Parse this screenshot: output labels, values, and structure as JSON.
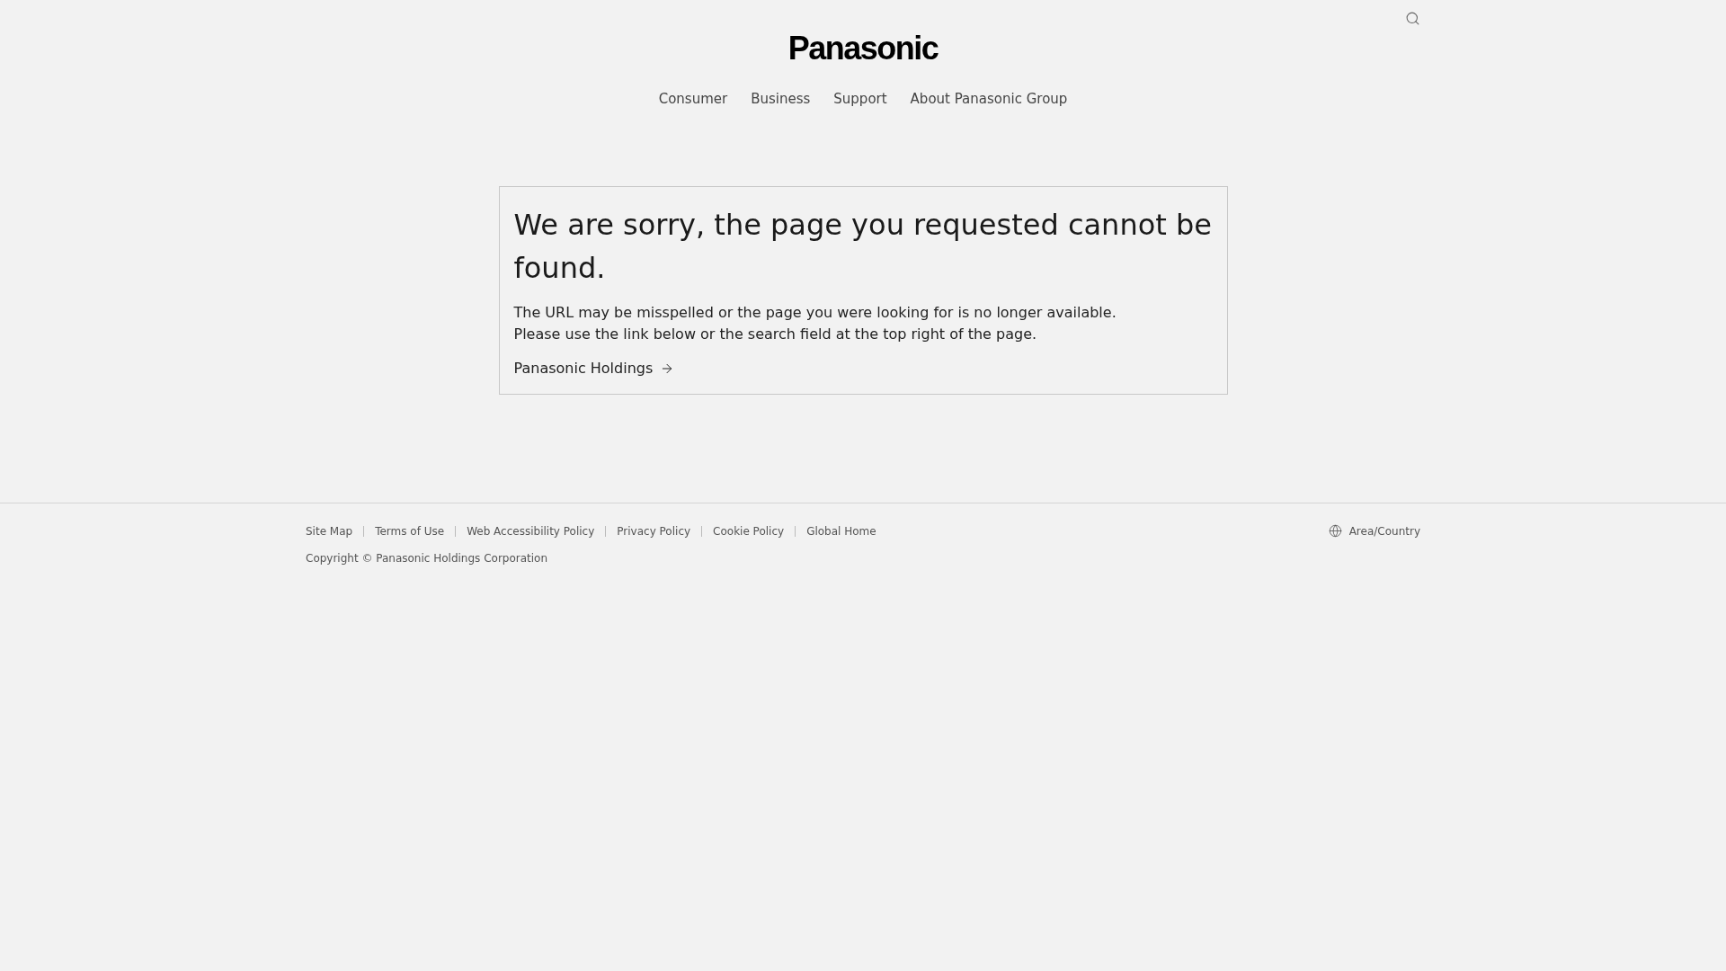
{
  "header": {
    "logo": "Panasonic",
    "nav": [
      {
        "label": "Consumer"
      },
      {
        "label": "Business"
      },
      {
        "label": "Support"
      },
      {
        "label": "About Panasonic Group"
      }
    ]
  },
  "error_card": {
    "title": "We are sorry, the page you requested cannot be found.",
    "lines": [
      "The URL may be misspelled or the page you were looking for is no longer available.",
      "Please use the link below or the search field at the top right of the page."
    ],
    "link": "Panasonic Holdings"
  },
  "footer": {
    "links": [
      "Site Map",
      "Terms of Use",
      "Web Accessibility Policy",
      "Privacy Policy",
      "Cookie Policy",
      "Global Home"
    ],
    "area_link": "Area/Country",
    "copyright": "Copyright © Panasonic Holdings Corporation"
  }
}
